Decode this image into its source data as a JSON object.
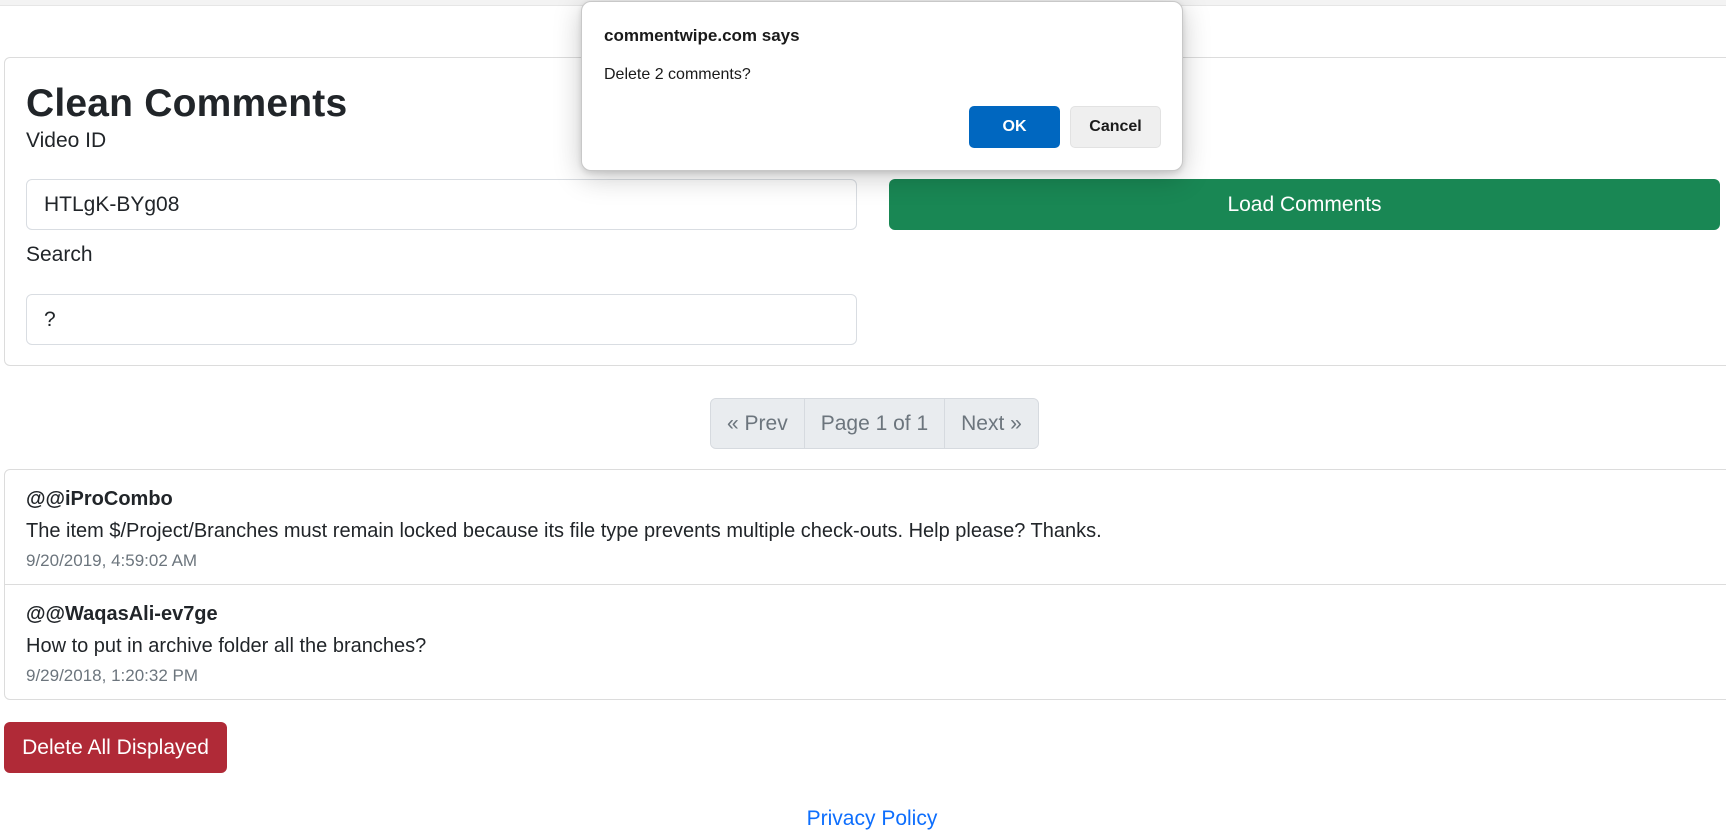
{
  "form": {
    "title": "Clean Comments",
    "video_id_label": "Video ID",
    "video_id_value": "HTLgK-BYg08",
    "search_label": "Search",
    "search_value": "?",
    "load_button": "Load Comments"
  },
  "pagination": {
    "prev": "« Prev",
    "page_info": "Page 1 of 1",
    "next": "Next »"
  },
  "comments": [
    {
      "author": "@@iProCombo",
      "text": "The item $/Project/Branches must remain locked because its file type prevents multiple check-outs. Help please? Thanks.",
      "date": "9/20/2019, 4:59:02 AM"
    },
    {
      "author": "@@WaqasAli-ev7ge",
      "text": "How to put in archive folder all the branches?",
      "date": "9/29/2018, 1:20:32 PM"
    }
  ],
  "delete_button": "Delete All Displayed",
  "footer": {
    "privacy_link": "Privacy Policy"
  },
  "dialog": {
    "title": "commentwipe.com says",
    "message": "Delete 2 comments?",
    "ok": "OK",
    "cancel": "Cancel"
  },
  "colors": {
    "load_button": "#198754",
    "delete_button": "#b02a37",
    "link": "#0d6efd",
    "dialog_ok": "#0067c0"
  }
}
